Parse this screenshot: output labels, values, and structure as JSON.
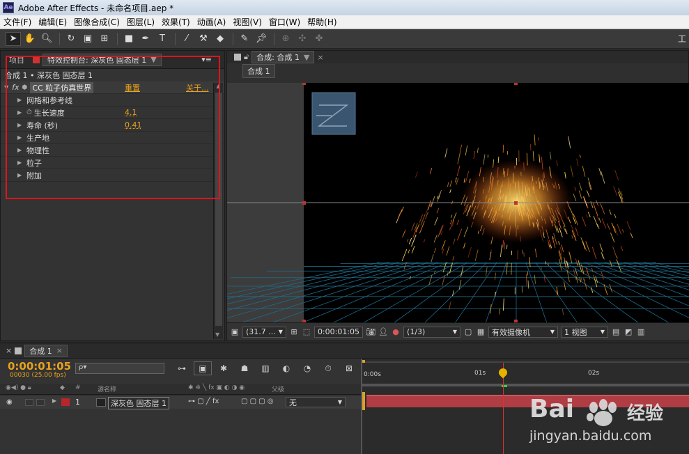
{
  "app": {
    "title": "Adobe After Effects - 未命名项目.aep *",
    "logo": "Ae",
    "workspace": "工"
  },
  "menu": [
    "文件(F)",
    "编辑(E)",
    "图像合成(C)",
    "图层(L)",
    "效果(T)",
    "动画(A)",
    "视图(V)",
    "窗口(W)",
    "帮助(H)"
  ],
  "left_panel": {
    "tab_project": "项目",
    "tab_effect_controls": "特效控制台: 深灰色 固态层 1",
    "breadcrumb": "合成 1 • 深灰色 固态层 1",
    "effect_name": "CC 粒子仿真世界",
    "reset": "重置",
    "about": "关于...",
    "props": [
      {
        "label": "网格和参考线",
        "value": ""
      },
      {
        "label": "生长速度",
        "value": "4.1"
      },
      {
        "label": "寿命 (秒)",
        "value": "0.41"
      },
      {
        "label": "生产地",
        "value": ""
      },
      {
        "label": "物理性",
        "value": ""
      },
      {
        "label": "粒子",
        "value": ""
      },
      {
        "label": "附加",
        "value": ""
      }
    ]
  },
  "comp_panel": {
    "tab": "合成: 合成 1",
    "subtab": "合成 1",
    "footer": {
      "zoom": "(31.7 ...",
      "time": "0:00:01:05",
      "resolution": "(1/3)",
      "camera": "有效摄像机",
      "views": "1 视图"
    }
  },
  "timeline": {
    "tab": "合成 1",
    "timecode": "0:00:01:05",
    "fps": "00030 (25.00 fps)",
    "search_placeholder": "ρ▾",
    "col_source": "源名称",
    "col_parent": "父级",
    "col_num": "#",
    "layer": {
      "num": "1",
      "name": "深灰色 固态层 1",
      "parent": "无"
    },
    "ruler": [
      "0:00s",
      "01s",
      "02s"
    ]
  },
  "watermark": {
    "brand": "Bai",
    "brand2": "经验",
    "url": "jingyan.baidu.com"
  },
  "colors": {
    "accent": "#e8a21c",
    "highlight_box": "#e0141c",
    "layer_bar": "#b03c44",
    "timeline_cursor": "#e03030"
  }
}
